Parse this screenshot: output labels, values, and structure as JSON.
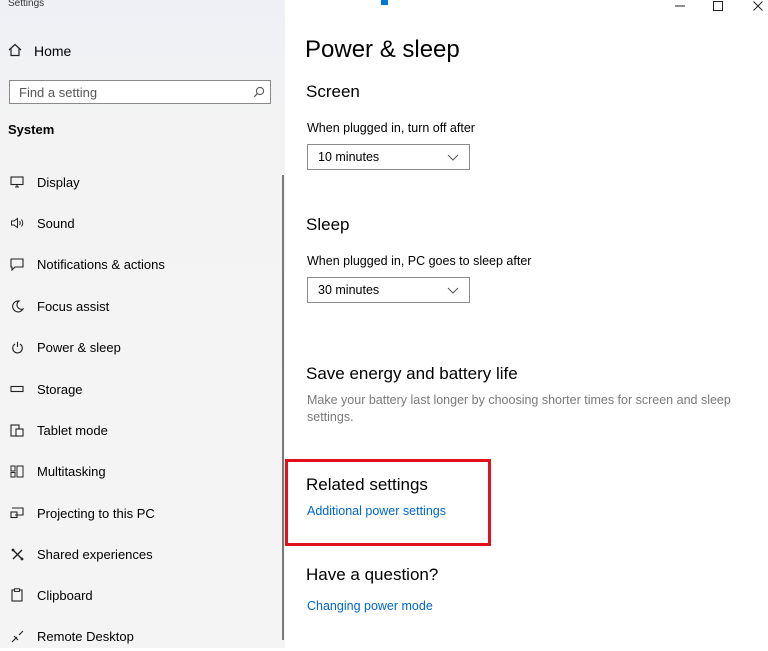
{
  "window": {
    "title": "Settings",
    "minimize_icon": "minimize-icon",
    "maximize_icon": "maximize-icon",
    "close_icon": "close-icon",
    "accent": "#0078d7"
  },
  "sidebar": {
    "home_label": "Home",
    "search_placeholder": "Find a setting",
    "section_label": "System",
    "items": [
      {
        "label": "Display",
        "icon": "display-icon"
      },
      {
        "label": "Sound",
        "icon": "sound-icon"
      },
      {
        "label": "Notifications & actions",
        "icon": "notifications-icon"
      },
      {
        "label": "Focus assist",
        "icon": "focus-assist-icon"
      },
      {
        "label": "Power & sleep",
        "icon": "power-icon"
      },
      {
        "label": "Storage",
        "icon": "storage-icon"
      },
      {
        "label": "Tablet mode",
        "icon": "tablet-mode-icon"
      },
      {
        "label": "Multitasking",
        "icon": "multitasking-icon"
      },
      {
        "label": "Projecting to this PC",
        "icon": "projecting-icon"
      },
      {
        "label": "Shared experiences",
        "icon": "shared-experiences-icon"
      },
      {
        "label": "Clipboard",
        "icon": "clipboard-icon"
      },
      {
        "label": "Remote Desktop",
        "icon": "remote-desktop-icon"
      }
    ]
  },
  "main": {
    "title": "Power & sleep",
    "screen": {
      "heading": "Screen",
      "label": "When plugged in, turn off after",
      "value": "10 minutes"
    },
    "sleep": {
      "heading": "Sleep",
      "label": "When plugged in, PC goes to sleep after",
      "value": "30 minutes"
    },
    "energy": {
      "heading": "Save energy and battery life",
      "description": "Make your battery last longer by choosing shorter times for screen and sleep settings."
    },
    "related": {
      "heading": "Related settings",
      "link": "Additional power settings",
      "highlight_color": "#e0101d"
    },
    "question": {
      "heading": "Have a question?",
      "link": "Changing power mode"
    },
    "link_color": "#0066cc"
  }
}
